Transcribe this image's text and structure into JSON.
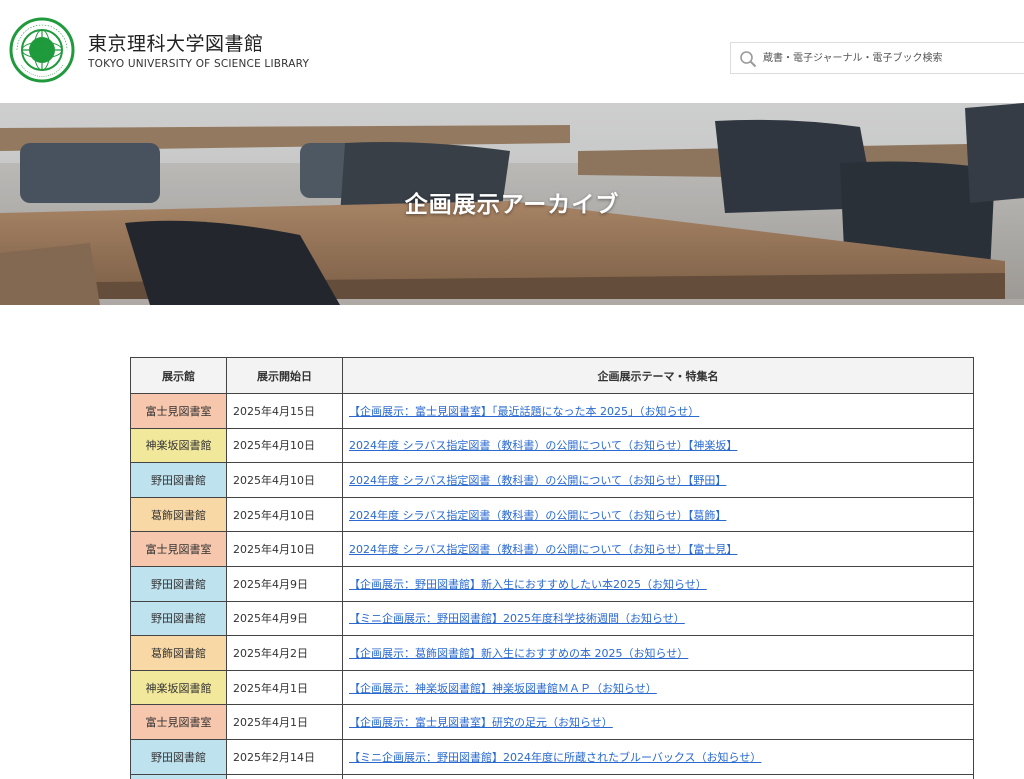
{
  "header": {
    "logo_text": "TOKYO UNIVERSITY OF SCIENCE since 1881",
    "title_jp": "東京理科大学図書館",
    "title_en": "TOKYO UNIVERSITY OF SCIENCE LIBRARY",
    "search_placeholder": "蔵書・電子ジャーナル・電子ブック検索"
  },
  "hero": {
    "title": "企画展示アーカイブ"
  },
  "table": {
    "headers": [
      "展示館",
      "展示開始日",
      "企画展示テーマ・特集名"
    ],
    "rows": [
      {
        "library": "富士見図書室",
        "date": "2025年4月15日",
        "title": "【企画展示：富士見図書室】「最近話題になった本 2025」（お知らせ）",
        "color": "#f6c6ad"
      },
      {
        "library": "神楽坂図書館",
        "date": "2025年4月10日",
        "title": "2024年度 シラバス指定図書（教科書）の公開について（お知らせ）【神楽坂】",
        "color": "#f2e89c"
      },
      {
        "library": "野田図書館",
        "date": "2025年4月10日",
        "title": "2024年度 シラバス指定図書（教科書）の公開について（お知らせ）【野田】",
        "color": "#bfe2ef"
      },
      {
        "library": "葛飾図書館",
        "date": "2025年4月10日",
        "title": "2024年度 シラバス指定図書（教科書）の公開について（お知らせ）【葛飾】",
        "color": "#f8d9a6"
      },
      {
        "library": "富士見図書室",
        "date": "2025年4月10日",
        "title": "2024年度 シラバス指定図書（教科書）の公開について（お知らせ）【富士見】",
        "color": "#f6c6ad"
      },
      {
        "library": "野田図書館",
        "date": "2025年4月9日",
        "title": "【企画展示：野田図書館】新入生におすすめしたい本2025（お知らせ）",
        "color": "#bfe2ef"
      },
      {
        "library": "野田図書館",
        "date": "2025年4月9日",
        "title": "【ミニ企画展示：野田図書館】2025年度科学技術週間（お知らせ）",
        "color": "#bfe2ef"
      },
      {
        "library": "葛飾図書館",
        "date": "2025年4月2日",
        "title": "【企画展示：葛飾図書館】新入生におすすめの本 2025（お知らせ）",
        "color": "#f8d9a6"
      },
      {
        "library": "神楽坂図書館",
        "date": "2025年4月1日",
        "title": "【企画展示：神楽坂図書館】神楽坂図書館ＭＡＰ（お知らせ）",
        "color": "#f2e89c"
      },
      {
        "library": "富士見図書室",
        "date": "2025年4月1日",
        "title": "【企画展示：富士見図書室】研究の足元（お知らせ）",
        "color": "#f6c6ad"
      },
      {
        "library": "野田図書館",
        "date": "2025年2月14日",
        "title": "【ミニ企画展示：野田図書館】2024年度に所蔵されたブルーバックス（お知らせ）",
        "color": "#bfe2ef"
      },
      {
        "library": "",
        "date": "",
        "title": "",
        "color": "#bfe2ef"
      }
    ]
  },
  "colors": {
    "link": "#2a6ad0",
    "logo_green": "#1f9a3c"
  }
}
